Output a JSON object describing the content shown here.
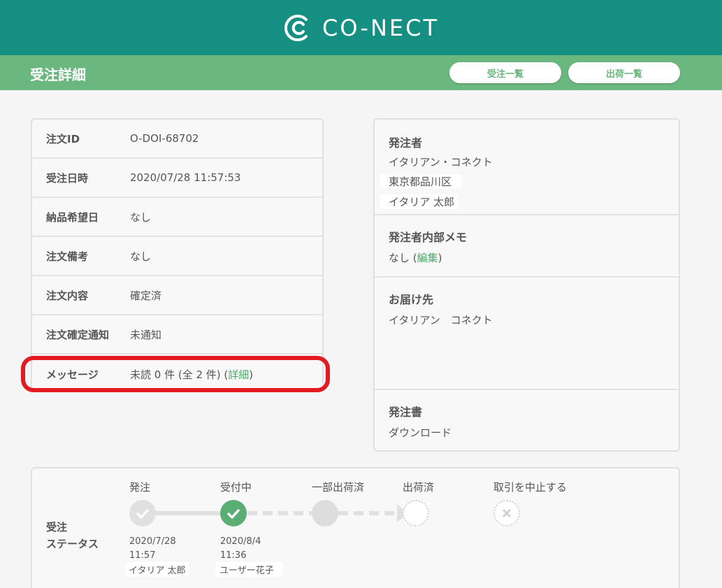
{
  "header": {
    "brand": "CO-NECT"
  },
  "subheader": {
    "title": "受注詳細",
    "order_list_button": "受注一覧",
    "shipping_list_button": "出荷一覧"
  },
  "order": {
    "rows": [
      {
        "label": "注文ID",
        "value": "O-DOI-68702"
      },
      {
        "label": "受注日時",
        "value": "2020/07/28 11:57:53"
      },
      {
        "label": "納品希望日",
        "value": "なし"
      },
      {
        "label": "注文備考",
        "value": "なし"
      },
      {
        "label": "注文内容",
        "value": "確定済"
      },
      {
        "label": "注文確定通知",
        "value": "未通知"
      }
    ],
    "message": {
      "label": "メッセージ",
      "value": "未読 0 件 (全 2 件) (",
      "link": "詳細",
      "close": ")"
    }
  },
  "orderer": {
    "title": "発注者",
    "company": "イタリアン・コネクト",
    "address": "東京都品川区",
    "person": "イタリア 太郎"
  },
  "memo": {
    "title": "発注者内部メモ",
    "value": "なし (",
    "link": "編集",
    "close": ")"
  },
  "delivery": {
    "title": "お届け先",
    "value": "イタリアン　コネクト"
  },
  "purchase_order": {
    "title": "発注書",
    "link": "ダウンロード"
  },
  "status": {
    "label_line1": "受注",
    "label_line2": "ステータス",
    "steps": [
      {
        "name": "発注",
        "date": "2020/7/28",
        "time": "11:57",
        "user": "イタリア 太郎"
      },
      {
        "name": "受付中",
        "date": "2020/8/4",
        "time": "11:36",
        "user": "ユーザー花子"
      },
      {
        "name": "一部出荷済"
      },
      {
        "name": "出荷済"
      },
      {
        "name": "取引を中止する"
      }
    ]
  }
}
